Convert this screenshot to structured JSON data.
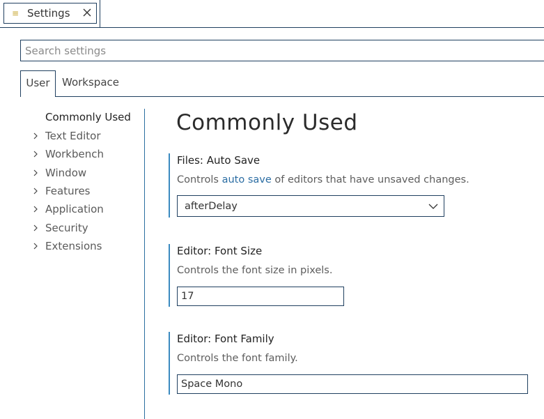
{
  "tab": {
    "label": "Settings",
    "icon": "settings-file-icon"
  },
  "search": {
    "placeholder": "Search settings",
    "value": ""
  },
  "scope_tabs": [
    {
      "label": "User",
      "active": true
    },
    {
      "label": "Workspace",
      "active": false
    }
  ],
  "toc": {
    "items": [
      {
        "label": "Commonly Used",
        "expandable": false,
        "active": true
      },
      {
        "label": "Text Editor",
        "expandable": true,
        "active": false
      },
      {
        "label": "Workbench",
        "expandable": true,
        "active": false
      },
      {
        "label": "Window",
        "expandable": true,
        "active": false
      },
      {
        "label": "Features",
        "expandable": true,
        "active": false
      },
      {
        "label": "Application",
        "expandable": true,
        "active": false
      },
      {
        "label": "Security",
        "expandable": true,
        "active": false
      },
      {
        "label": "Extensions",
        "expandable": true,
        "active": false
      }
    ]
  },
  "main": {
    "heading": "Commonly Used",
    "settings": [
      {
        "title_prefix": "Files: ",
        "title_name": "Auto Save",
        "desc_before": "Controls ",
        "desc_link": "auto save",
        "desc_after": " of editors that have unsaved changes.",
        "control": "select",
        "value": "afterDelay"
      },
      {
        "title_prefix": "Editor: ",
        "title_name": "Font Size",
        "desc": "Controls the font size in pixels.",
        "control": "number",
        "value": "17"
      },
      {
        "title_prefix": "Editor: ",
        "title_name": "Font Family",
        "desc": "Controls the font family.",
        "control": "text",
        "value": "Space Mono"
      }
    ]
  },
  "colors": {
    "border": "#1f3f5f",
    "accent": "#3a8ac0",
    "link": "#2b6da3",
    "tab_icon": "#c6a32a"
  }
}
